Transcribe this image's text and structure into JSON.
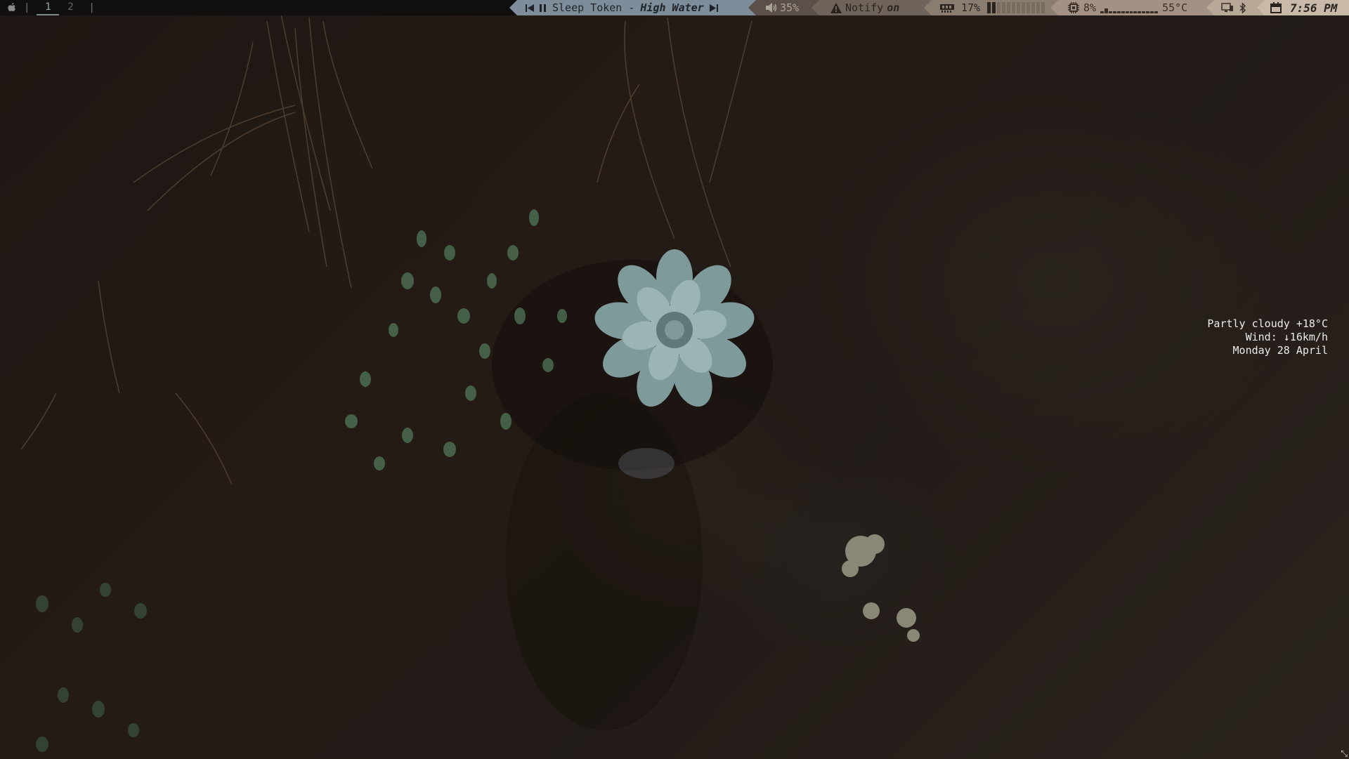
{
  "topbar": {
    "workspaces": [
      {
        "label": "1",
        "active": true
      },
      {
        "label": "2",
        "active": false
      }
    ],
    "music": {
      "artist": "Sleep Token -",
      "title": "High Water"
    },
    "volume": "35%",
    "notify": {
      "label": "Notify",
      "state": "on"
    },
    "memory": {
      "percent": "17%",
      "level": 0.17
    },
    "cpu": {
      "percent": "8%",
      "temp": "55°C"
    },
    "clock": {
      "time": "7:56 PM"
    }
  },
  "weather": {
    "line1": "Partly cloudy +18°C",
    "line2": "Wind: ↓16km/h",
    "line3": "Monday 28 April"
  },
  "colors": {
    "bar_bg": "#0f0f0f",
    "music_bg": "#7d8e9a",
    "volume_bg": "#5a5049",
    "notify_bg": "#6e645b",
    "memory_bg": "#8a7c6f",
    "cpu_bg": "#a39283",
    "tray_bg": "#b8a898",
    "clock_bg": "#c9b9a8"
  },
  "icons": {
    "menu": "apple-icon",
    "prev": "skip-back-icon",
    "pause": "pause-icon",
    "next": "skip-forward-icon",
    "volume": "speaker-icon",
    "notify": "warning-icon",
    "memory": "memory-chip-icon",
    "cpu": "cpu-icon",
    "network": "monitor-network-icon",
    "bluetooth": "bluetooth-icon",
    "calendar": "calendar-icon"
  }
}
